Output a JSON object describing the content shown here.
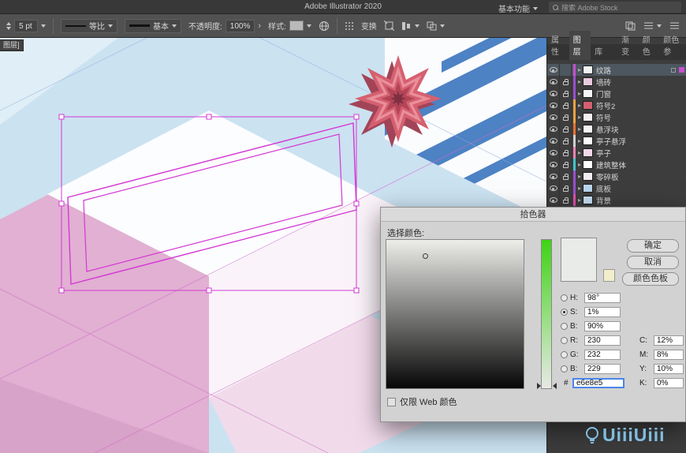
{
  "app": {
    "title": "Adobe Illustrator 2020",
    "workspace_switcher": "基本功能",
    "search_placeholder": "搜索 Adobe Stock"
  },
  "control_bar": {
    "stroke_value": "5 pt",
    "variable_width_profile": "等比",
    "brush_definition": "基本",
    "opacity_label": "不透明度:",
    "opacity_value": "100%",
    "style_label": "样式:",
    "transform_label": "变换"
  },
  "canvas": {
    "floating_tab": "图层]"
  },
  "panel": {
    "tabs": [
      {
        "label": "属性"
      },
      {
        "label": "图层"
      },
      {
        "label": "库"
      }
    ],
    "tabs2": [
      "渐变",
      "颜色",
      "颜色参"
    ],
    "layers": [
      {
        "name": "纹路",
        "color": "#c84fd0",
        "thumb": "#f2f2f2",
        "locked": false,
        "selected": true
      },
      {
        "name": "墙砖",
        "color": "#9a4fd0",
        "thumb": "#e9cadd",
        "locked": true,
        "selected": false
      },
      {
        "name": "门窗",
        "color": "#9a4fd0",
        "thumb": "#f4f4f6",
        "locked": true,
        "selected": false
      },
      {
        "name": "符号2",
        "color": "#eda23f",
        "thumb": "#d4606e",
        "locked": true,
        "selected": false
      },
      {
        "name": "符号",
        "color": "#eda23f",
        "thumb": "#f5eef0",
        "locked": true,
        "selected": false
      },
      {
        "name": "悬浮块",
        "color": "#e5732f",
        "thumb": "#f4f4f4",
        "locked": true,
        "selected": false
      },
      {
        "name": "亭子悬浮",
        "color": "#cfcfcf",
        "thumb": "#fafafa",
        "locked": true,
        "selected": false
      },
      {
        "name": "亭子",
        "color": "#ef83b5",
        "thumb": "#f2d9e8",
        "locked": true,
        "selected": false
      },
      {
        "name": "建筑整体",
        "color": "#3fc6cc",
        "thumb": "#ffffff",
        "locked": true,
        "selected": false
      },
      {
        "name": "零碎板",
        "color": "#9a4fd0",
        "thumb": "#f1edf2",
        "locked": true,
        "selected": false
      },
      {
        "name": "底板",
        "color": "#9a4fd0",
        "thumb": "#bad5ed",
        "locked": true,
        "selected": false
      },
      {
        "name": "背景",
        "color": "#e04fae",
        "thumb": "#c5ddf1",
        "locked": true,
        "selected": false
      }
    ]
  },
  "dialog": {
    "title": "拾色器",
    "choose_label": "选择颜色:",
    "ok": "确定",
    "cancel": "取消",
    "swatches": "颜色色板",
    "web_only": "仅限 Web 颜色",
    "hex": {
      "label": "#",
      "value": "e6e8e5"
    },
    "fields": {
      "h": {
        "label": "H:",
        "value": "98°"
      },
      "s": {
        "label": "S:",
        "value": "1%"
      },
      "b": {
        "label": "B:",
        "value": "90%"
      },
      "r": {
        "label": "R:",
        "value": "230"
      },
      "g": {
        "label": "G:",
        "value": "232"
      },
      "b2": {
        "label": "B:",
        "value": "229"
      },
      "c": {
        "label": "C:",
        "value": "12%"
      },
      "m": {
        "label": "M:",
        "value": "8%"
      },
      "y": {
        "label": "Y:",
        "value": "10%"
      },
      "k": {
        "label": "K:",
        "value": "0%"
      }
    },
    "preview_color": "#e9ebe8",
    "swatch_secondary": "#f2eecb",
    "field_top": "#edeeea",
    "field_bottom": "#060606",
    "hue_top": "#3fd315",
    "hue_bottom": "#e8e9e6"
  },
  "art": {
    "sky": "#cbe2f1",
    "pale": "#e0eef7",
    "wall": "#fbfcfe",
    "stripe": "#4d82c4",
    "ground": "#e1b0d2",
    "ground_dark": "#d8a3c8",
    "top_white": "#fcfdfe",
    "face_white": "#faf3f9",
    "floor_pale": "#f1dbeb",
    "block_pink": "#e3b3d4",
    "block_top": "#f3e2ee",
    "star": "#d5606f",
    "star_dark": "#a24458",
    "star_ring": "#e98f9b",
    "star_core": "#b34457",
    "star_center": "#7e2f42",
    "selection": "#d438d4"
  },
  "watermark": "UiiiUiii"
}
